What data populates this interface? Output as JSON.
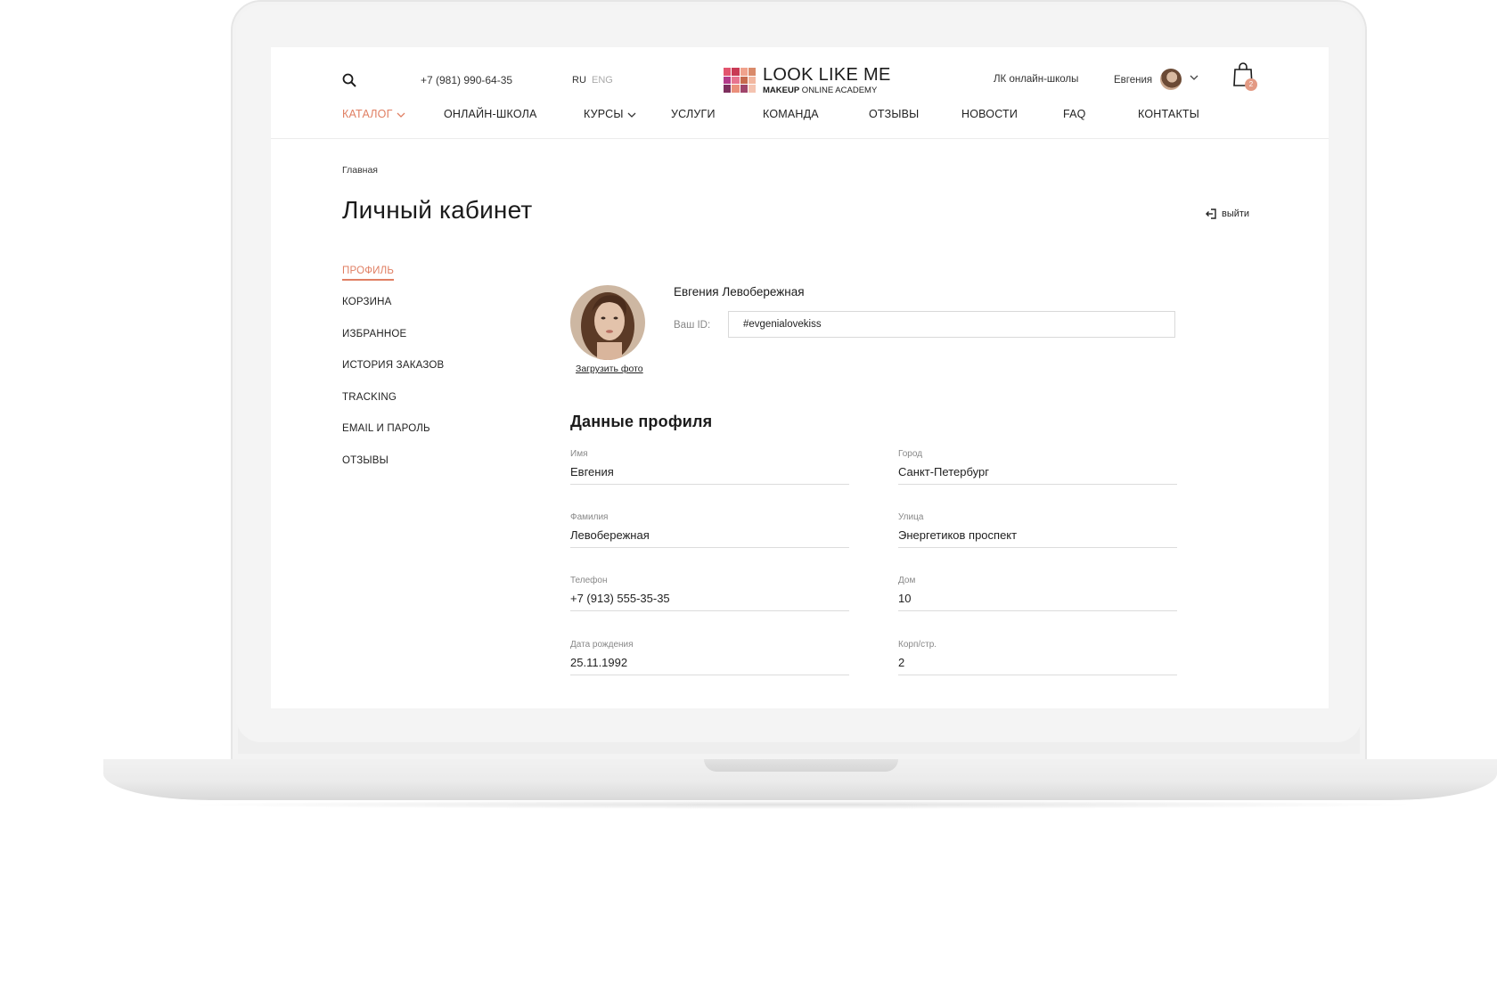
{
  "header": {
    "phone": "+7 (981) 990-64-35",
    "lang_ru": "RU",
    "lang_eng": "ENG",
    "logo_title": "LOOK LIKE ME",
    "logo_sub_bold": "MAKEUP",
    "logo_sub_rest": " ONLINE ACADEMY",
    "lk_school": "ЛК онлайн-школы",
    "user_name": "Евгения",
    "cart_count": "2"
  },
  "nav": {
    "items": [
      "КАТАЛОГ",
      "ОНЛАЙН-ШКОЛА",
      "КУРСЫ",
      "УСЛУГИ",
      "КОМАНДА",
      "ОТЗЫВЫ",
      "НОВОСТИ",
      "FAQ",
      "КОНТАКТЫ"
    ]
  },
  "breadcrumb": "Главная",
  "page_title": "Личный кабинет",
  "logout_label": "выйти",
  "sidebar": {
    "items": [
      "ПРОФИЛЬ",
      "КОРЗИНА",
      "ИЗБРАННОЕ",
      "ИСТОРИЯ ЗАКАЗОВ",
      "TRACKING",
      "EMAIL И ПАРОЛЬ",
      "ОТЗЫВЫ"
    ]
  },
  "profile": {
    "full_name": "Евгения Левобережная",
    "upload_label": "Загрузить фото",
    "id_label": "Ваш ID:",
    "id_value": "#evgenialovekiss"
  },
  "section_title": "Данные профиля",
  "fields": {
    "first_name": {
      "label": "Имя",
      "value": "Евгения"
    },
    "last_name": {
      "label": "Фамилия",
      "value": "Левобережная"
    },
    "phone": {
      "label": "Телефон",
      "value": "+7 (913) 555-35-35"
    },
    "birth_date": {
      "label": "Дата рождения",
      "value": "25.11.1992"
    },
    "city": {
      "label": "Город",
      "value": "Санкт-Петербург"
    },
    "street": {
      "label": "Улица",
      "value": "Энергетиков проспект"
    },
    "house": {
      "label": "Дом",
      "value": "10"
    },
    "building": {
      "label": "Корп/стр.",
      "value": "2"
    }
  },
  "colors": {
    "accent": "#e07f63",
    "logo_palette": [
      "#e2546e",
      "#c93a55",
      "#f0a28c",
      "#d98a6a",
      "#b33b8a",
      "#e7748f",
      "#c76a4e",
      "#f2b7a0",
      "#7e2f5e",
      "#ea8f7b",
      "#a0456b",
      "#f4c3b0"
    ]
  }
}
